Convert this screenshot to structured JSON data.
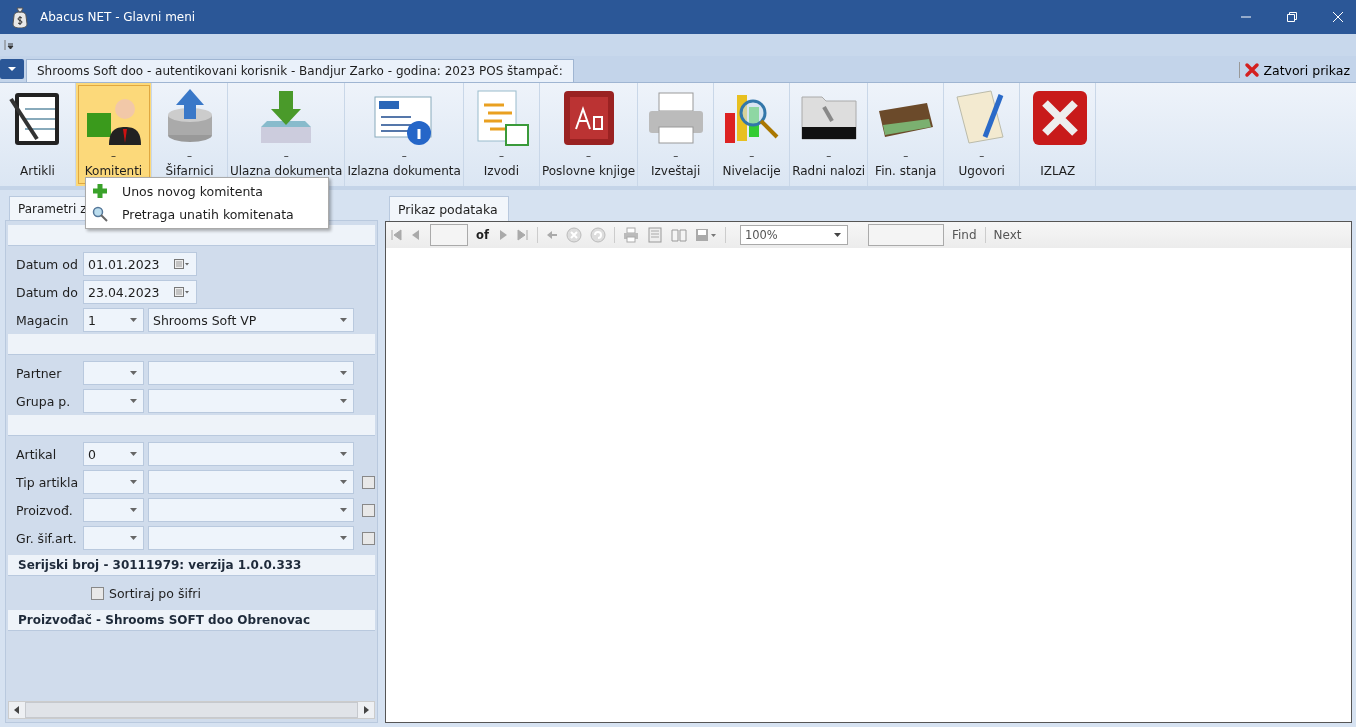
{
  "window": {
    "title": "Abacus NET - Glavni meni"
  },
  "doc_tab": {
    "label": "Shrooms Soft doo - autentikovani korisnik - Bandjur Zarko - godina: 2023 POS štampač:",
    "selected": true
  },
  "close_view": {
    "label": "Zatvori prikaz"
  },
  "ribbon": [
    {
      "label": "Artikli",
      "selected": false
    },
    {
      "label": "Komitenti",
      "sub": "–",
      "selected": true
    },
    {
      "label": "Šifarnici",
      "sub": "–",
      "selected": false
    },
    {
      "label": "Ulazna dokumenta",
      "sub": "–",
      "selected": false
    },
    {
      "label": "Izlazna dokumenta",
      "sub": "–",
      "selected": false
    },
    {
      "label": "Izvodi",
      "sub": "–",
      "selected": false
    },
    {
      "label": "Poslovne knjige",
      "sub": "–",
      "selected": false
    },
    {
      "label": "Izveštaji",
      "sub": "–",
      "selected": false
    },
    {
      "label": "Nivelacije",
      "sub": "–",
      "selected": false
    },
    {
      "label": "Radni nalozi",
      "sub": "–",
      "selected": false
    },
    {
      "label": "Fin. stanja",
      "sub": "–",
      "selected": false
    },
    {
      "label": "Ugovori",
      "sub": "–",
      "selected": false
    },
    {
      "label": "IZLAZ",
      "selected": false
    }
  ],
  "dropdown_menu": [
    {
      "label": "Unos novog komitenta"
    },
    {
      "label": "Pretraga unatih komitenata"
    }
  ],
  "left_panel": {
    "tab": "Parametri z",
    "rows": [
      {
        "kind": "band"
      },
      {
        "kind": "date",
        "label": "Datum od",
        "value": "01.01.2023"
      },
      {
        "kind": "date",
        "label": "Datum do",
        "value": "23.04.2023"
      },
      {
        "kind": "combo",
        "label": "Magacin",
        "code": "1",
        "value": "Shrooms Soft VP"
      },
      {
        "kind": "band"
      },
      {
        "kind": "combo",
        "label": "Partner",
        "code": "",
        "value": ""
      },
      {
        "kind": "combo",
        "label": "Grupa p.",
        "code": "",
        "value": ""
      },
      {
        "kind": "band"
      },
      {
        "kind": "combo",
        "label": "Artikal",
        "code": "0",
        "value": ""
      },
      {
        "kind": "combo",
        "label": "Tip artikla",
        "code": "",
        "value": "",
        "checked": false
      },
      {
        "kind": "combo",
        "label": "Proizvođ.",
        "code": "",
        "value": "",
        "checked": false
      },
      {
        "kind": "combo",
        "label": "Gr. šif.art.",
        "code": "",
        "value": "",
        "checked": false
      },
      {
        "kind": "info",
        "text": "Serijski broj - 30111979: verzija 1.0.0.333"
      },
      {
        "kind": "check",
        "label": "Sortiraj po šifri",
        "checked": false
      },
      {
        "kind": "info",
        "text": "Proizvođač - Shrooms SOFT doo Obrenovac"
      }
    ]
  },
  "right_panel": {
    "tab": "Prikaz podataka",
    "of_label": "of",
    "zoom": "100%",
    "find": "Find",
    "next": "Next"
  }
}
